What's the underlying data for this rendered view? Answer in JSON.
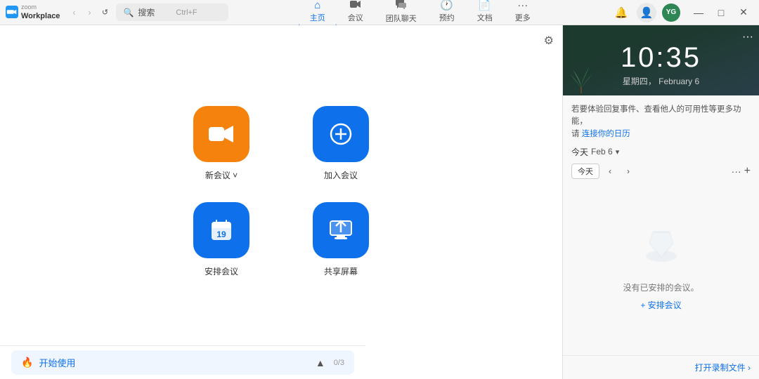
{
  "app": {
    "brand": "zoom",
    "title": "Workplace"
  },
  "titlebar": {
    "search_label": "搜索",
    "search_shortcut": "Ctrl+F",
    "back_disabled": true,
    "forward_disabled": true
  },
  "tabs": [
    {
      "id": "home",
      "label": "主页",
      "icon": "🏠",
      "active": true
    },
    {
      "id": "meeting",
      "label": "会议",
      "icon": "📹",
      "active": false
    },
    {
      "id": "team_chat",
      "label": "团队聊天",
      "icon": "💬",
      "active": false
    },
    {
      "id": "schedule",
      "label": "预约",
      "icon": "🕐",
      "active": false
    },
    {
      "id": "docs",
      "label": "文档",
      "icon": "📄",
      "active": false
    },
    {
      "id": "more",
      "label": "更多",
      "icon": "···",
      "active": false
    }
  ],
  "main": {
    "actions": [
      {
        "id": "new_meeting",
        "label": "新会议 ˅",
        "icon": "🎥",
        "color": "orange"
      },
      {
        "id": "join_meeting",
        "label": "加入会议",
        "icon": "➕",
        "color": "blue"
      },
      {
        "id": "arrange_meeting",
        "label": "安排会议",
        "icon": "📅",
        "color": "blue"
      },
      {
        "id": "share_screen",
        "label": "共享屏幕",
        "icon": "⬆",
        "color": "blue"
      }
    ],
    "getting_started": {
      "label": "🔥 开始使用",
      "progress": "0/3"
    },
    "open_recording": "打开录制文件 ›"
  },
  "calendar": {
    "time": "10:35",
    "weekday": "星期四",
    "date_full": "February 6",
    "connect_msg": "若要体验回复事件、查看他人的可用性等更多功能，",
    "connect_link_text": "连接你的日历",
    "today_label": "今天",
    "today_date": "Feb 6",
    "empty_msg": "没有已安排的会议。",
    "schedule_link": "+ 安排会议",
    "open_recording_link": "打开录制文件 ›"
  },
  "window_controls": {
    "minimize": "—",
    "maximize": "□",
    "close": "✕"
  },
  "avatar": {
    "initials": "YG",
    "color": "#2d8653"
  }
}
